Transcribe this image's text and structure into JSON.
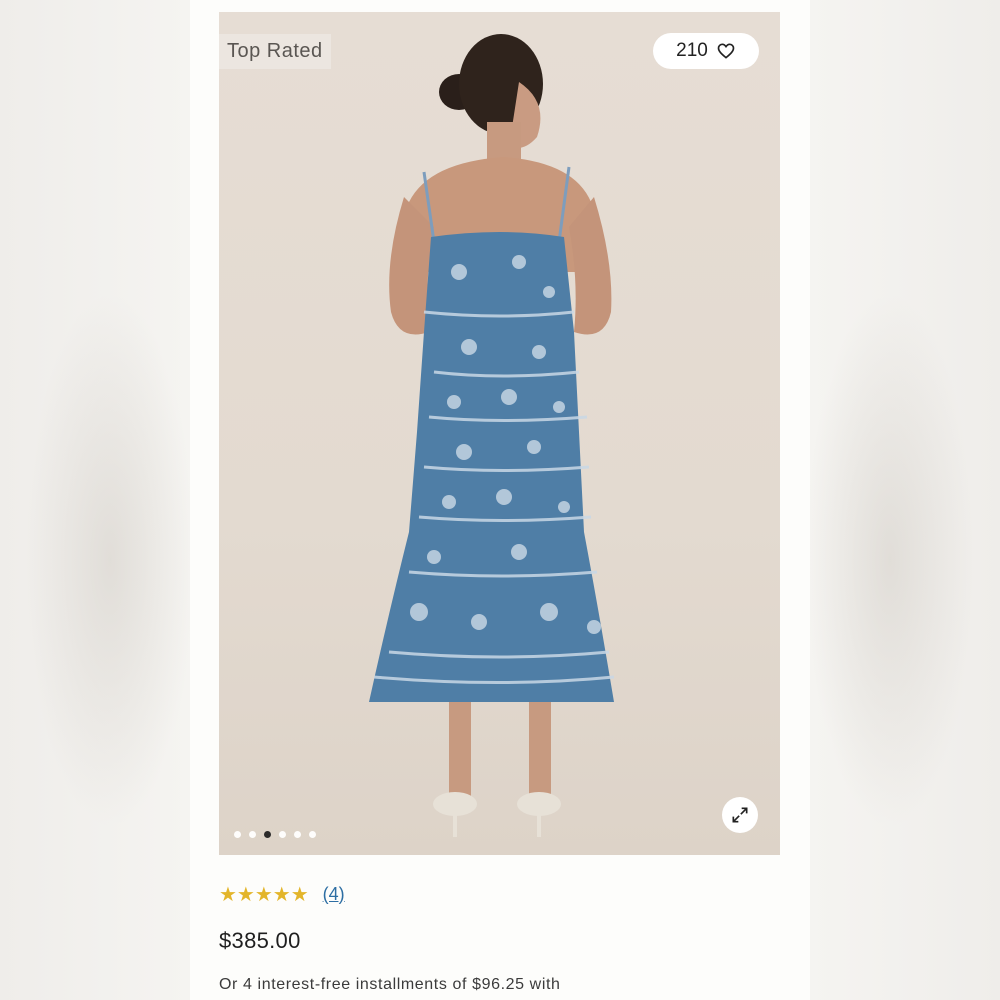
{
  "product": {
    "badge": "Top Rated",
    "favorites_count": "210",
    "gallery": {
      "total_images": 6,
      "active_index": 2
    },
    "rating": {
      "stars": "★★★★★",
      "review_count": "(4)"
    },
    "price": "$385.00",
    "installments_text": "Or 4 interest-free installments of $96.25 with"
  },
  "icons": {
    "favorite": "heart-icon",
    "expand": "expand-icon",
    "stars": "star-icon"
  },
  "colors": {
    "star": "#e3b52a",
    "link": "#2d6ea3",
    "dress": "#4f7ea6"
  }
}
